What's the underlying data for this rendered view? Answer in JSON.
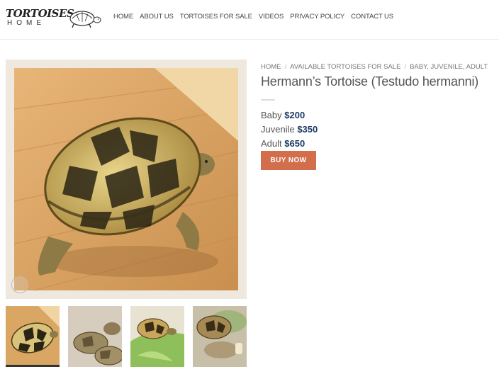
{
  "logo": {
    "line1": "TORTOISES",
    "line2": "HOME",
    "icon": "tortoise-logo-icon"
  },
  "nav": [
    "HOME",
    "ABOUT US",
    "TORTOISES FOR SALE",
    "VIDEOS",
    "PRIVACY POLICY",
    "CONTACT US"
  ],
  "breadcrumb": [
    "HOME",
    "AVAILABLE TORTOISES FOR SALE",
    "BABY, JUVENILE, ADULT"
  ],
  "product": {
    "title": "Hermann’s Tortoise (Testudo hermanni)",
    "prices": [
      {
        "label": "Baby",
        "amount": "$200"
      },
      {
        "label": "Juvenile",
        "amount": "$350"
      },
      {
        "label": "Adult",
        "amount": "$650"
      }
    ],
    "buy_label": "BUY NOW"
  },
  "colors": {
    "accent": "#d26e4b",
    "price": "#1e3a63",
    "text": "#555555"
  },
  "gallery": {
    "zoom_icon": "zoom-icon",
    "thumbnail_count": 4
  }
}
